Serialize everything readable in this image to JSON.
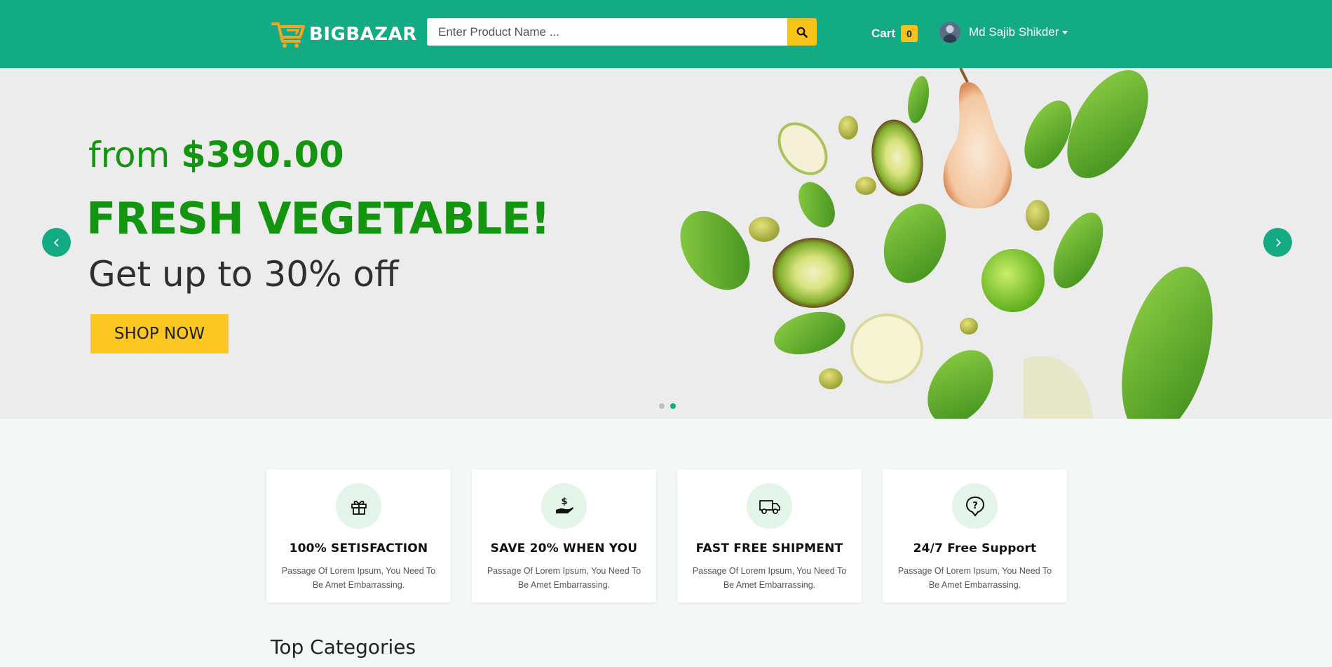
{
  "brand": {
    "name": "BIGBAZAR",
    "accent": "#12ab84",
    "highlight": "#f8c21c"
  },
  "search": {
    "placeholder": "Enter Product Name ...",
    "value": "",
    "button_icon": "search-icon"
  },
  "cart": {
    "label": "Cart",
    "count": "0"
  },
  "user": {
    "name": "Md Sajib Shikder",
    "menu_icon": "caret-down-icon"
  },
  "hero": {
    "from_text": "from",
    "price": "$390.00",
    "title": "FRESH VEGETABLE!",
    "subtitle": "Get up to 30% off",
    "cta": "SHOP NOW",
    "prev_icon": "chevron-left-icon",
    "next_icon": "chevron-right-icon",
    "slides": 2,
    "active_slide": 2
  },
  "features": [
    {
      "icon": "gift-icon",
      "title": "100% SETISFACTION",
      "text": "Passage Of Lorem Ipsum, You Need To Be Amet Embarrassing."
    },
    {
      "icon": "money-hand-icon",
      "title": "SAVE 20% WHEN YOU",
      "text": "Passage Of Lorem Ipsum, You Need To Be Amet Embarrassing."
    },
    {
      "icon": "truck-icon",
      "title": "FAST FREE SHIPMENT",
      "text": "Passage Of Lorem Ipsum, You Need To Be Amet Embarrassing."
    },
    {
      "icon": "support-icon",
      "title": "24/7 Free Support",
      "text": "Passage Of Lorem Ipsum, You Need To Be Amet Embarrassing."
    }
  ],
  "sections": {
    "top_categories": "Top Categories"
  }
}
